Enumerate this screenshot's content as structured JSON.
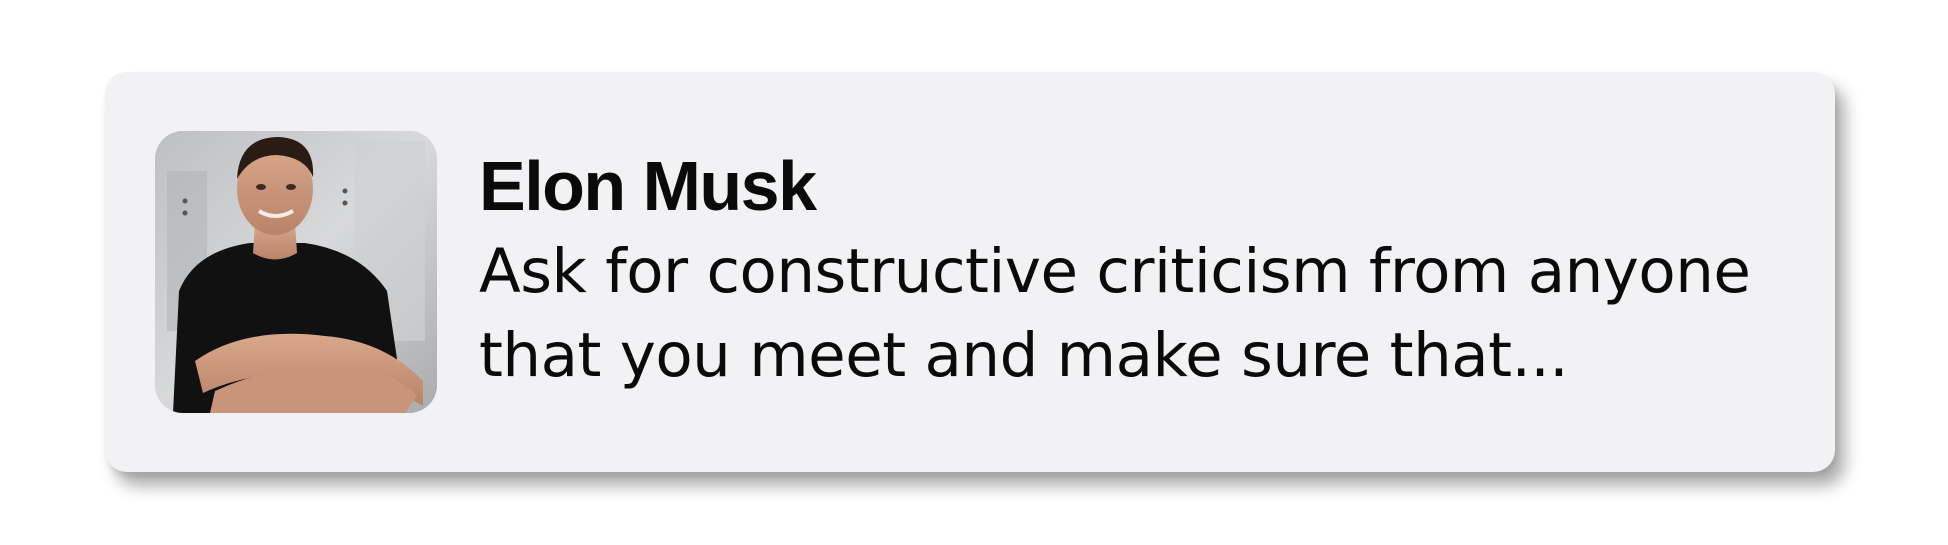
{
  "notification": {
    "sender_name": "Elon Musk",
    "message_preview": "Ask for constructive criticism from anyone that you meet and make sure that...",
    "avatar": "person-photo"
  },
  "colors": {
    "card_background": "#f2f2f4",
    "text": "#0a0a0a",
    "page_background": "#ffffff"
  }
}
